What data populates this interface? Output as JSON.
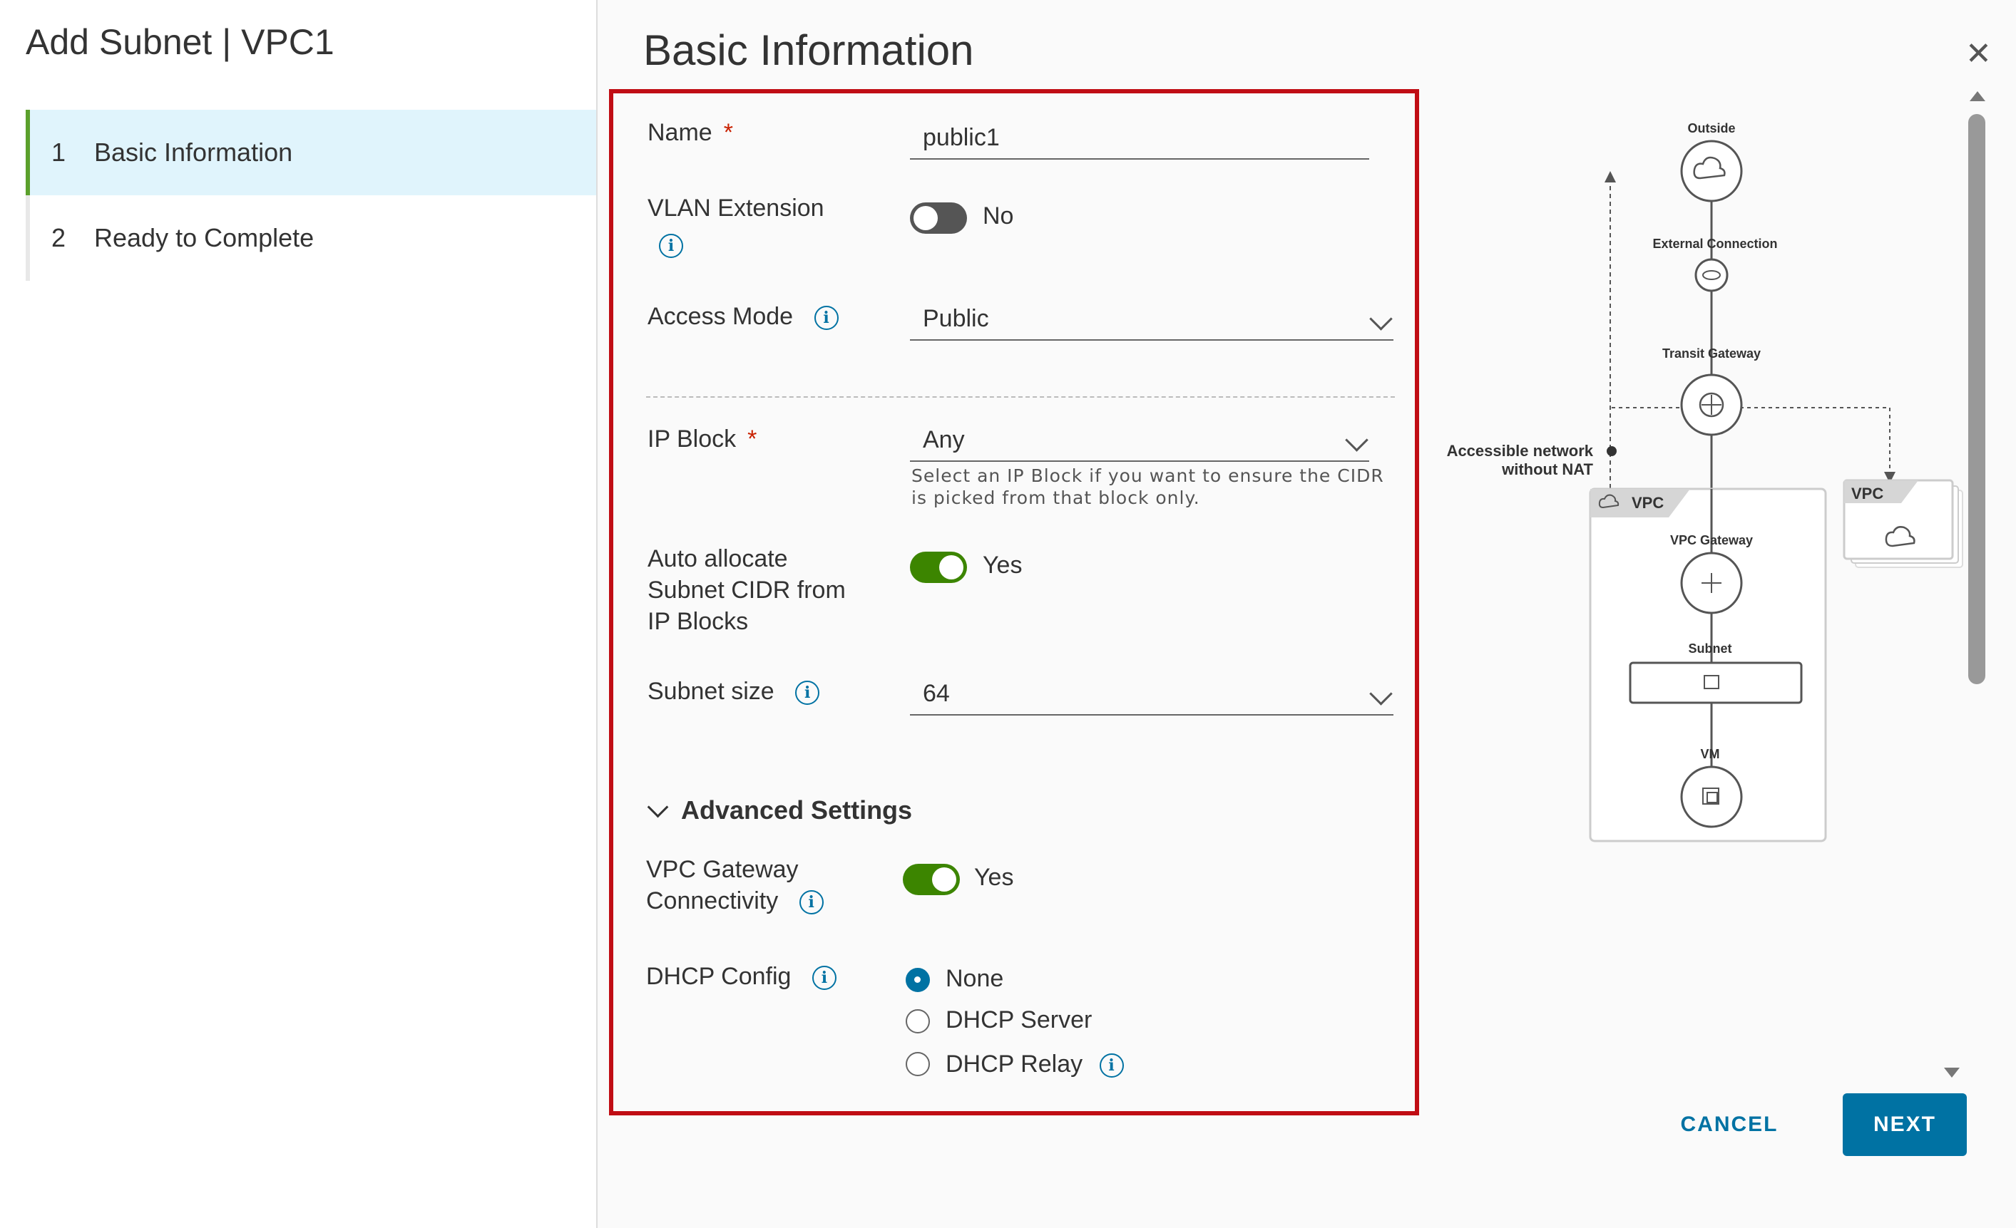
{
  "wizard": {
    "title": "Add Subnet | VPC1",
    "steps": [
      {
        "num": "1",
        "label": "Basic Information",
        "active": true
      },
      {
        "num": "2",
        "label": "Ready to Complete",
        "active": false
      }
    ]
  },
  "page": {
    "title": "Basic Information",
    "close_icon": "close-icon"
  },
  "form": {
    "name": {
      "label": "Name",
      "required_mark": "*",
      "value": "public1"
    },
    "vlan_extension": {
      "label": "VLAN Extension",
      "toggle_state": false,
      "toggle_text": "No",
      "info_icon": "info-icon"
    },
    "access_mode": {
      "label": "Access Mode",
      "value": "Public",
      "info_icon": "info-icon"
    },
    "ip_block": {
      "label": "IP Block",
      "required_mark": "*",
      "value": "Any",
      "helper_line1": "Select an IP Block if you want to ensure the CIDR",
      "helper_line2": "is picked from that block only."
    },
    "auto_allocate": {
      "label_line1": "Auto allocate",
      "label_line2": "Subnet CIDR from",
      "label_line3": "IP Blocks",
      "toggle_state": true,
      "toggle_text": "Yes"
    },
    "subnet_size": {
      "label": "Subnet size",
      "value": "64",
      "info_icon": "info-icon"
    },
    "advanced": {
      "title": "Advanced Settings",
      "expanded": true,
      "vpc_gateway": {
        "label_line1": "VPC Gateway",
        "label_line2": "Connectivity",
        "toggle_state": true,
        "toggle_text": "Yes",
        "info_icon": "info-icon"
      },
      "dhcp": {
        "label": "DHCP Config",
        "info_icon": "info-icon",
        "options": [
          {
            "label": "None",
            "selected": true
          },
          {
            "label": "DHCP Server",
            "selected": false
          },
          {
            "label": "DHCP Relay",
            "selected": false
          }
        ]
      }
    }
  },
  "diagram": {
    "outside": "Outside",
    "external_connection": "External Connection",
    "transit_gateway": "Transit Gateway",
    "accessible_line1": "Accessible network",
    "accessible_line2": "without NAT",
    "vpc_tab": "VPC",
    "vpc_tab_right": "VPC",
    "vpc_gateway": "VPC Gateway",
    "subnet": "Subnet",
    "vm": "VM"
  },
  "footer": {
    "cancel_label": "CANCEL",
    "next_label": "NEXT"
  },
  "colors": {
    "accent": "#0072a3",
    "toggle_on": "#3c8500",
    "highlight_border": "#c00d14",
    "active_step_bg": "#e0f4fc",
    "active_step_bar": "#5ba02c"
  }
}
